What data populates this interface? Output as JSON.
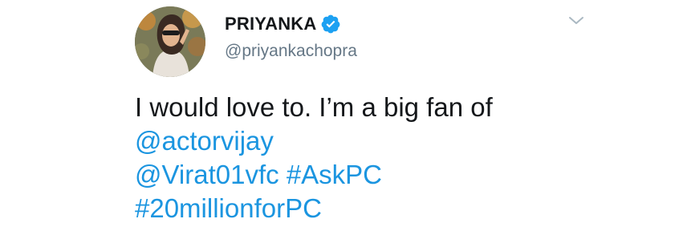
{
  "tweet": {
    "author": {
      "display_name": "PRIYANKA",
      "handle": "@priyankachopra",
      "verified": true
    },
    "menu_icon": "chevron-down-icon",
    "text": {
      "line1": "I would love to. I’m a big fan of",
      "mention1": "@actorvijay",
      "mention2": "@Virat01vfc",
      "hashtag1": "#AskPC",
      "hashtag2": "#20millionforPC"
    }
  },
  "colors": {
    "link": "#1b95e0",
    "verified_badge": "#1da1f2",
    "handle_gray": "#657786",
    "text": "#14171a"
  }
}
